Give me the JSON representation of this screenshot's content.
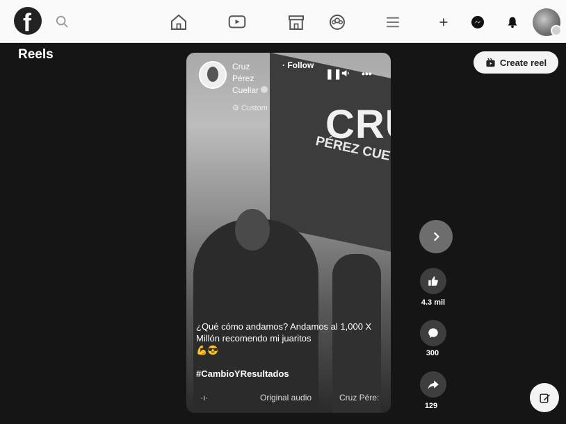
{
  "header": {
    "logo_letter": "f",
    "nav_icons": [
      "home-icon",
      "video-icon",
      "marketplace-icon",
      "groups-icon",
      "menu-icon"
    ],
    "right_icons": [
      "plus-icon",
      "messenger-icon",
      "notifications-icon"
    ]
  },
  "page": {
    "title": "Reels",
    "create_reel_label": "Create reel"
  },
  "reel": {
    "author_first": "Cruz",
    "author_middle": "Pérez",
    "author_last": "Cuellar",
    "privacy_label": "Custom",
    "follow_label": "· Follow",
    "caption": "¿Qué cómo andamos? Andamos al 1,000 X Millón recomendo mi juaritos",
    "caption_emoji": "💪😎",
    "hashtag": "#CambioYResultados",
    "audio_label": "Original audio",
    "audio_artist": "Cruz Pére:",
    "flag_text": "CRU",
    "flag_subtext": "PÉREZ CUE"
  },
  "actions": {
    "like_count": "4.3 mil",
    "comment_count": "300",
    "share_count": "129"
  },
  "colors": {
    "nav_background": "#fafafa",
    "page_background": "#151515",
    "button_light": "#f4f4f4"
  }
}
